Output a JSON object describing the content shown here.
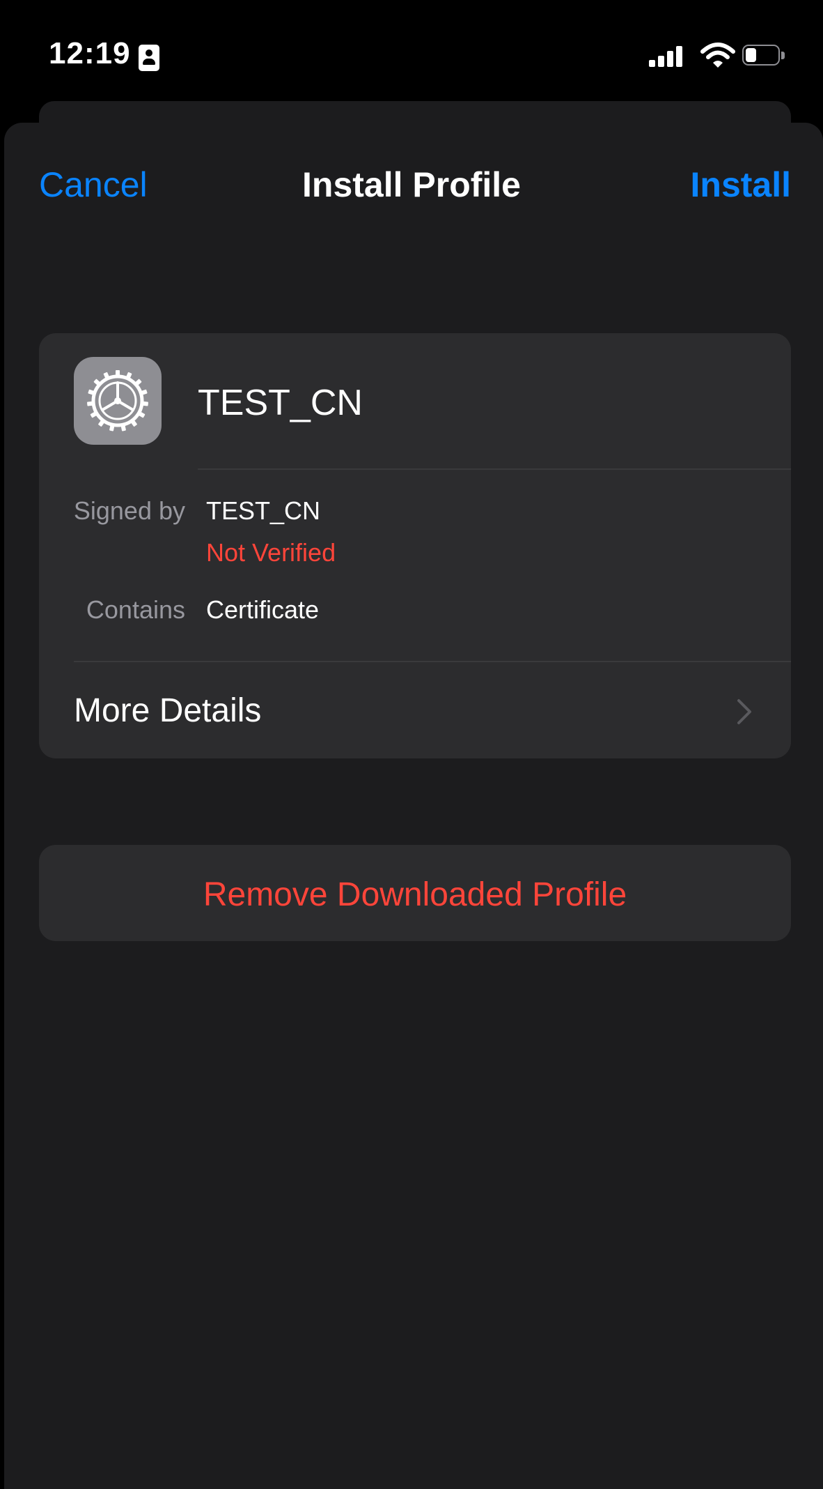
{
  "status_bar": {
    "time": "12:19",
    "icons": [
      "contact-card-icon",
      "cellular-signal-icon",
      "wifi-icon",
      "battery-icon"
    ],
    "battery_level": 0.35
  },
  "nav": {
    "cancel_label": "Cancel",
    "title": "Install Profile",
    "install_label": "Install"
  },
  "profile": {
    "icon": "gear-icon",
    "name": "TEST_CN",
    "signed_by_label": "Signed by",
    "signed_by_value": "TEST_CN",
    "verification_status": "Not Verified",
    "contains_label": "Contains",
    "contains_value": "Certificate",
    "more_details_label": "More Details"
  },
  "actions": {
    "remove_label": "Remove Downloaded Profile"
  },
  "colors": {
    "accent_blue": "#0a84ff",
    "destructive_red": "#ff453a",
    "sheet_background": "#1c1c1e",
    "card_background": "#2c2c2e"
  }
}
